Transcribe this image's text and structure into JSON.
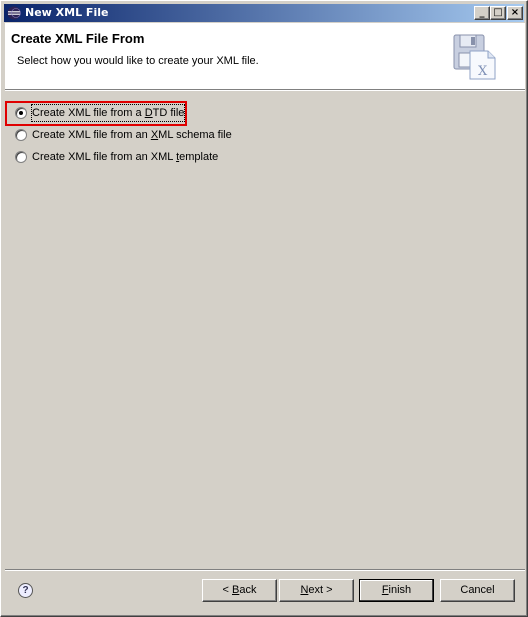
{
  "window": {
    "title": "New XML File",
    "controls": {
      "minimize": "_",
      "maximize": "□",
      "close": "×"
    }
  },
  "header": {
    "title": "Create XML File From",
    "description": "Select how you would like to create your XML file.",
    "icon": "xml-file-wizard-icon"
  },
  "options": [
    {
      "pre": "Create XML file from a ",
      "mnemonic": "D",
      "post": "TD file",
      "checked": true
    },
    {
      "pre": "Create XML file from an ",
      "mnemonic": "X",
      "post": "ML schema file",
      "checked": false
    },
    {
      "pre": "Create XML file from an XML ",
      "mnemonic": "t",
      "post": "emplate",
      "checked": false
    }
  ],
  "footer": {
    "help_label": "?",
    "back": {
      "pre": "< ",
      "mnemonic": "B",
      "post": "ack"
    },
    "next": {
      "pre": "",
      "mnemonic": "N",
      "post": "ext >"
    },
    "finish": {
      "pre": "",
      "mnemonic": "F",
      "post": "inish"
    },
    "cancel": "Cancel"
  },
  "colors": {
    "titlebar_start": "#0a246a",
    "titlebar_end": "#a6caf0",
    "dialog_bg": "#d4d0c8",
    "highlight": "#e00000"
  }
}
